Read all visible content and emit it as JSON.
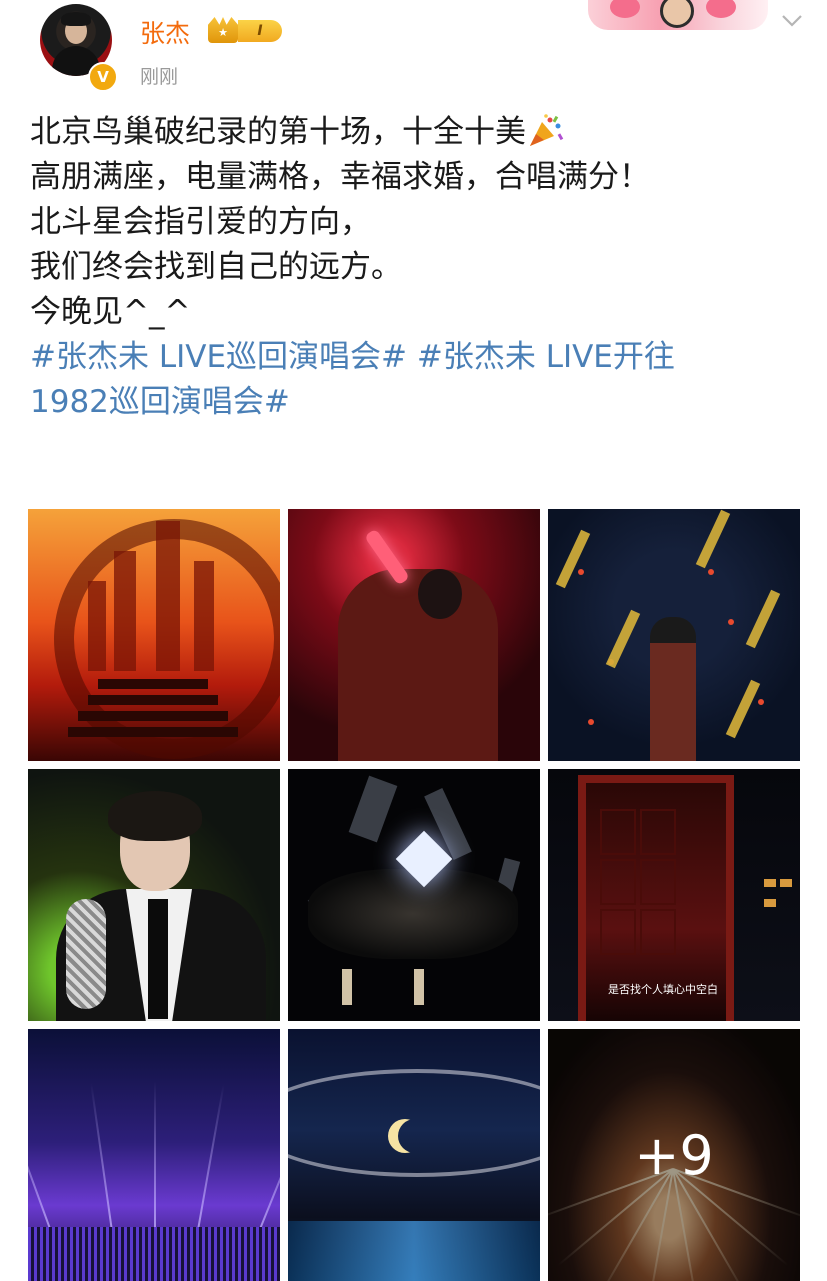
{
  "header": {
    "username": "张杰",
    "verified_mark": "V",
    "crown_label": "★",
    "level_badge": "I",
    "timestamp": "刚刚"
  },
  "post": {
    "lines": [
      "北京鸟巢破纪录的第十场，十全十美",
      "高朋满座，电量满格，幸福求婚，合唱满分！",
      "北斗星会指引爱的方向，",
      "我们终会找到自己的远方。",
      "今晚见^_^"
    ],
    "hashtag_lines": [
      "#张杰未 LIVE巡回演唱会# #张杰未 LIVE开往",
      "1982巡回演唱会#"
    ]
  },
  "gallery": {
    "tiles": [
      {
        "name": "photo-stage-red-city"
      },
      {
        "name": "photo-singer-red-coat"
      },
      {
        "name": "photo-singer-confetti"
      },
      {
        "name": "photo-singer-closeup-suit"
      },
      {
        "name": "photo-dark-crystal-stage"
      },
      {
        "name": "photo-red-booth-stage"
      },
      {
        "name": "photo-purple-lasers-crowd"
      },
      {
        "name": "photo-moon-stage"
      },
      {
        "name": "photo-fireworks"
      }
    ],
    "subtitle_in_photo": "是否找个人填心中空白",
    "more_count_label": "+9"
  },
  "colors": {
    "username": "#f36b0d",
    "hashtag": "#4a7fb6",
    "verified_badge": "#f2a90f",
    "timestamp": "#9a9a9a"
  },
  "icons": [
    "verified-icon",
    "crown-icon",
    "chevron-down-icon",
    "party-popper-icon"
  ]
}
